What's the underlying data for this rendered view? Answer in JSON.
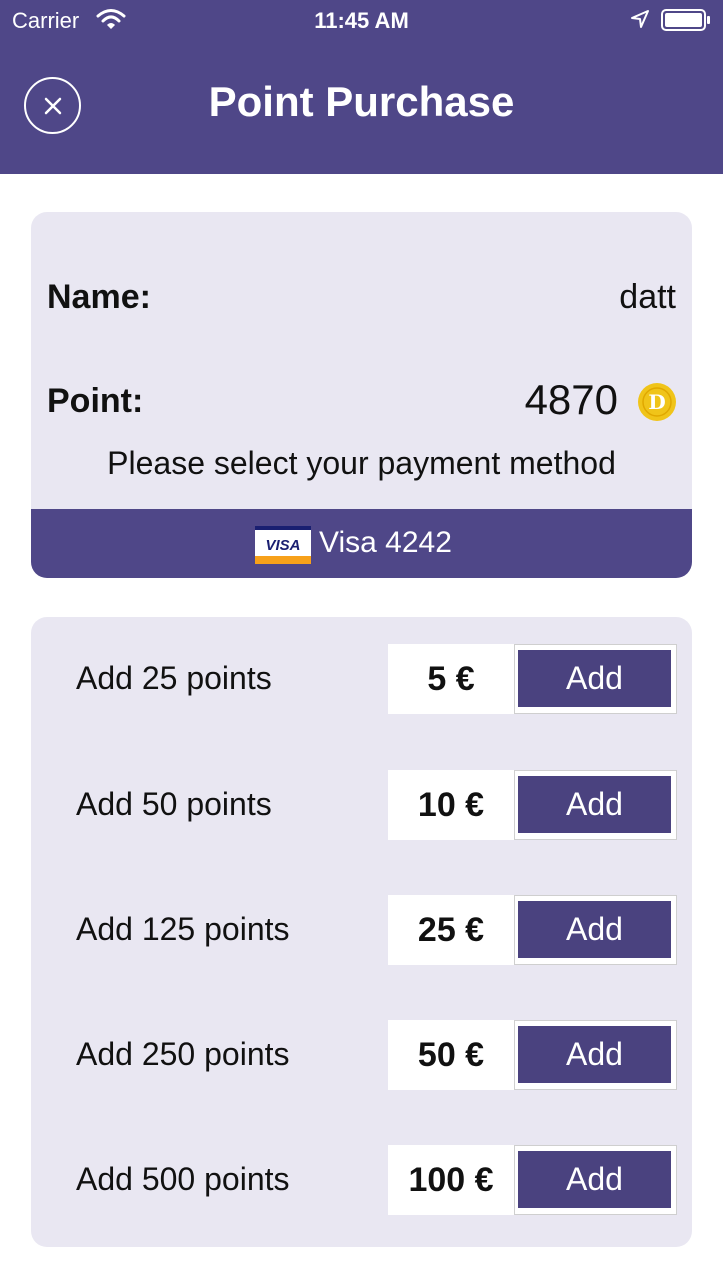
{
  "status_bar": {
    "carrier": "Carrier",
    "time": "11:45 AM"
  },
  "header": {
    "title": "Point Purchase"
  },
  "account": {
    "name_label": "Name:",
    "name_value": "datt",
    "point_label": "Point:",
    "point_value": "4870",
    "coin_symbol": "D"
  },
  "payment": {
    "prompt": "Please select your payment method",
    "method": "Visa 4242",
    "card_brand": "VISA"
  },
  "packages": [
    {
      "label": "Add 25 points",
      "price": "5 €",
      "button": "Add"
    },
    {
      "label": "Add 50 points",
      "price": "10 €",
      "button": "Add"
    },
    {
      "label": "Add 125 points",
      "price": "25 €",
      "button": "Add"
    },
    {
      "label": "Add 250 points",
      "price": "50 €",
      "button": "Add"
    },
    {
      "label": "Add 500 points",
      "price": "100 €",
      "button": "Add"
    }
  ],
  "colors": {
    "header": "#4f4788",
    "card": "#e9e7f2",
    "button": "#4a427f",
    "coin": "#f0c419"
  }
}
